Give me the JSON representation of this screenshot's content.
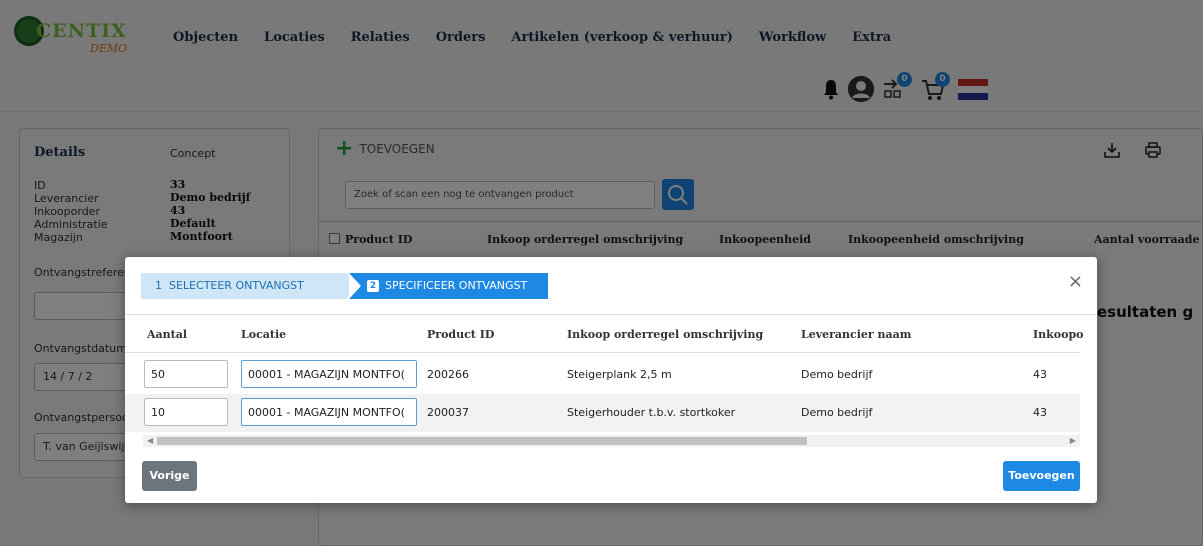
{
  "logo": {
    "text": "CENTIX",
    "sub": "DEMO"
  },
  "nav": [
    "Objecten",
    "Locaties",
    "Relaties",
    "Orders",
    "Artikelen (verkoop & verhuur)",
    "Workflow",
    "Extra"
  ],
  "header_icons": {
    "notifications_icon": "bell-icon",
    "profile_icon": "user-icon",
    "scan_badge": "0",
    "cart_badge": "0",
    "language_icon": "flag-nl-icon"
  },
  "details": {
    "title": "Details",
    "status": "Concept",
    "fields": [
      {
        "label": "ID",
        "value": "33"
      },
      {
        "label": "Leverancier",
        "value": "Demo bedrijf"
      },
      {
        "label": "Inkooporder",
        "value": "43"
      },
      {
        "label": "Administratie",
        "value": "Default"
      },
      {
        "label": "Magazijn",
        "value": "Montfoort"
      }
    ],
    "ontvangstreferentie_label": "Ontvangstreferenti",
    "ontvangstreferentie_value": "",
    "ontvangstdatum_label": "Ontvangstdatum",
    "ontvangstdatum_value": "14 /  7  / 2",
    "ontvangstpersoon_label": "Ontvangstpersoon",
    "ontvangstpersoon_value": "T. van Geijlswijk ("
  },
  "toolbar": {
    "add_label": "TOEVOEGEN",
    "download_icon": "download-icon",
    "print_icon": "print-icon"
  },
  "search": {
    "placeholder": "Zoek of scan een nog te ontvangen product",
    "button_icon": "search-icon"
  },
  "table": {
    "headers": [
      "Product ID",
      "Inkoop orderregel omschrijving",
      "Inkoopeenheid",
      "Inkoopeenheid omschrijving",
      "Aantal voorraade"
    ],
    "no_results": "esultaten g"
  },
  "modal": {
    "steps": [
      {
        "num": "1",
        "label": "SELECTEER ONTVANGST"
      },
      {
        "num": "2",
        "label": "SPECIFICEER ONTVANGST"
      }
    ],
    "close": "×",
    "headers": [
      "Aantal",
      "Locatie",
      "Product ID",
      "Inkoop orderregel omschrijving",
      "Leverancier naam",
      "Inkoopo"
    ],
    "rows": [
      {
        "aantal": "50",
        "locatie": "00001 - MAGAZIJN MONTFO(",
        "product_id": "200266",
        "omschrijving": "Steigerplank 2,5 m",
        "leverancier": "Demo bedrijf",
        "inkooporder": "43"
      },
      {
        "aantal": "10",
        "locatie": "00001 - MAGAZIJN MONTFO(",
        "product_id": "200037",
        "omschrijving": "Steigerhouder t.b.v. stortkoker",
        "leverancier": "Demo bedrijf",
        "inkooporder": "43"
      }
    ],
    "prev_label": "Vorige",
    "add_label": "Toevoegen"
  },
  "colors": {
    "primary": "#1e88e5",
    "nav_text": "#1a2e4a",
    "add_green": "#2e9e3a"
  }
}
